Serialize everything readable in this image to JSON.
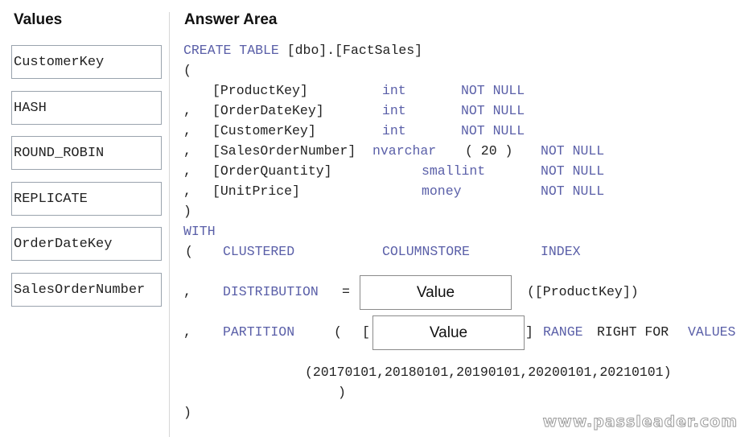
{
  "values_panel": {
    "title": "Values",
    "items": [
      "CustomerKey",
      "HASH",
      "ROUND_ROBIN",
      "REPLICATE",
      "OrderDateKey",
      "SalesOrderNumber"
    ]
  },
  "answer_area": {
    "title": "Answer Area",
    "create_kw": "CREATE TABLE",
    "table_name": "[dbo].[FactSales]",
    "open_paren": "(",
    "close_paren": ")",
    "comma": ",",
    "columns": [
      {
        "name": "[ProductKey]",
        "type": "int",
        "constraint": "NOT NULL"
      },
      {
        "name": "[OrderDateKey]",
        "type": "int",
        "constraint": "NOT NULL"
      },
      {
        "name": "[CustomerKey]",
        "type": "int",
        "constraint": "NOT NULL"
      },
      {
        "name": "[SalesOrderNumber]",
        "type": "nvarchar",
        "type_args": "( 20 )",
        "constraint": "NOT NULL"
      },
      {
        "name": "[OrderQuantity]",
        "type": "smallint",
        "constraint": "NOT NULL"
      },
      {
        "name": "[UnitPrice]",
        "type": "money",
        "constraint": "NOT NULL"
      }
    ],
    "with_kw": "WITH",
    "index_words": [
      "CLUSTERED",
      "COLUMNSTORE",
      "INDEX"
    ],
    "distribution_kw": "DISTRIBUTION",
    "equals": "=",
    "distribution_slot_placeholder": "Value",
    "distribution_suffix": "([ProductKey])",
    "partition_kw": "PARTITION",
    "bracket_open": "[",
    "bracket_close": "]",
    "partition_slot_placeholder": "Value",
    "range_kw": "RANGE",
    "right_for": "RIGHT FOR",
    "values_kw": "VALUES",
    "range_values": "(20170101,20180101,20190101,20200101,20210101)"
  },
  "watermark": "www.passleader.com"
}
